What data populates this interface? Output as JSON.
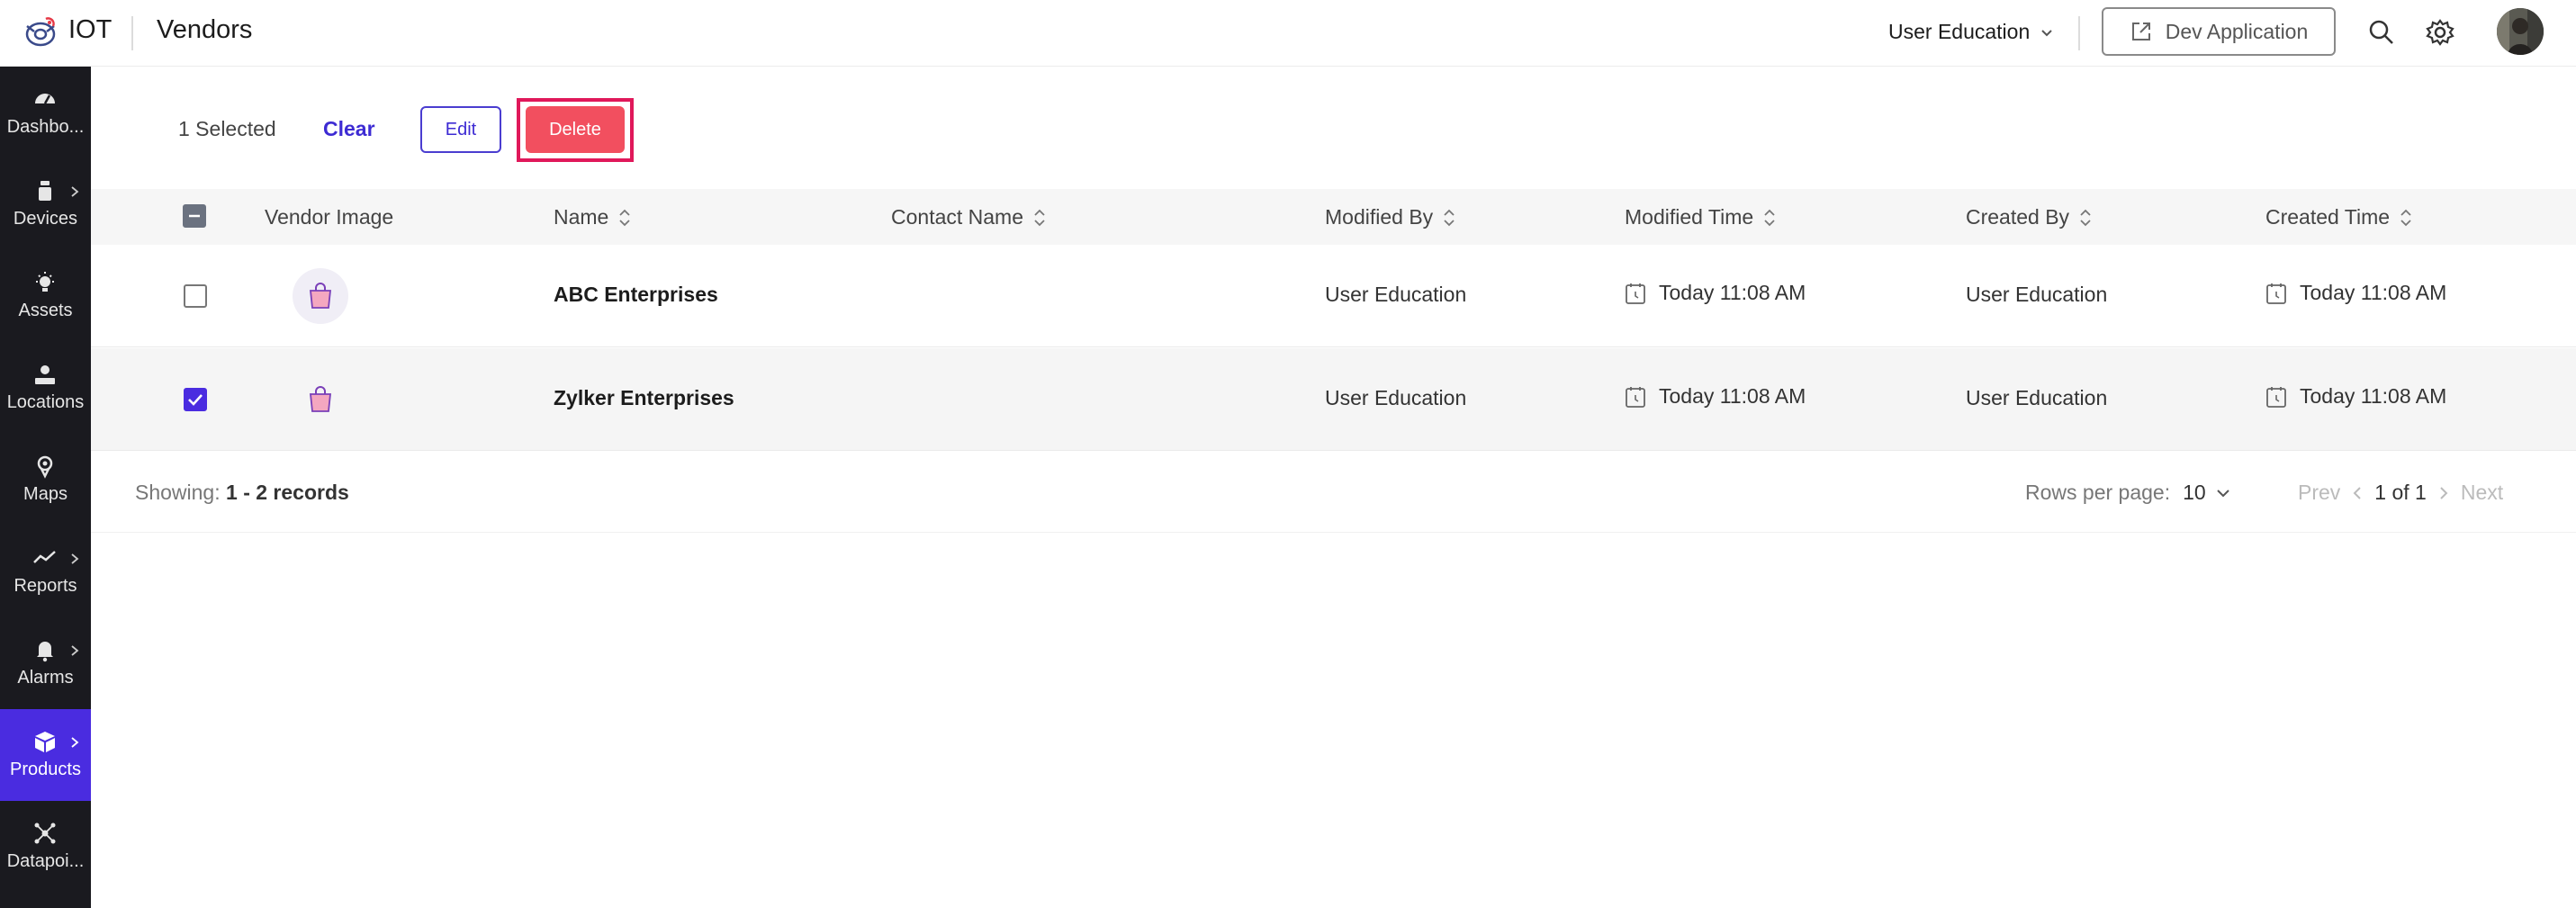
{
  "header": {
    "brand": "IOT",
    "page_title": "Vendors",
    "org_name": "User Education",
    "dev_app_label": "Dev Application"
  },
  "sidebar": {
    "items": [
      {
        "label": "Dashbo...",
        "icon": "dashboard-icon"
      },
      {
        "label": "Devices",
        "icon": "device-icon"
      },
      {
        "label": "Assets",
        "icon": "asset-icon"
      },
      {
        "label": "Locations",
        "icon": "location-icon"
      },
      {
        "label": "Maps",
        "icon": "map-pin-icon"
      },
      {
        "label": "Reports",
        "icon": "reports-icon"
      },
      {
        "label": "Alarms",
        "icon": "bell-icon"
      },
      {
        "label": "Products",
        "icon": "box-icon"
      },
      {
        "label": "Datapoi...",
        "icon": "datapoint-icon"
      }
    ],
    "active": "Products"
  },
  "actions": {
    "selected_text": "1 Selected",
    "clear_label": "Clear",
    "edit_label": "Edit",
    "delete_label": "Delete"
  },
  "table": {
    "columns": [
      "Vendor Image",
      "Name",
      "Contact Name",
      "Modified By",
      "Modified Time",
      "Created By",
      "Created Time"
    ],
    "rows": [
      {
        "name": "ABC Enterprises",
        "contact": "",
        "modified_by": "User Education",
        "modified_time": "Today 11:08 AM",
        "created_by": "User Education",
        "created_time": "Today 11:08 AM",
        "checked": false
      },
      {
        "name": "Zylker Enterprises",
        "contact": "",
        "modified_by": "User Education",
        "modified_time": "Today 11:08 AM",
        "created_by": "User Education",
        "created_time": "Today 11:08 AM",
        "checked": true
      }
    ]
  },
  "footer": {
    "showing_label": "Showing:",
    "showing_range": "1 - 2 records",
    "rows_per_page_label": "Rows per page:",
    "rows_per_page_value": "10",
    "prev_label": "Prev",
    "page_info": "1 of 1",
    "next_label": "Next"
  },
  "colors": {
    "accent": "#4a2ce0",
    "delete": "#f24f5f",
    "highlight_frame": "#e0185a",
    "sidebar_bg": "#1a1a1f"
  }
}
